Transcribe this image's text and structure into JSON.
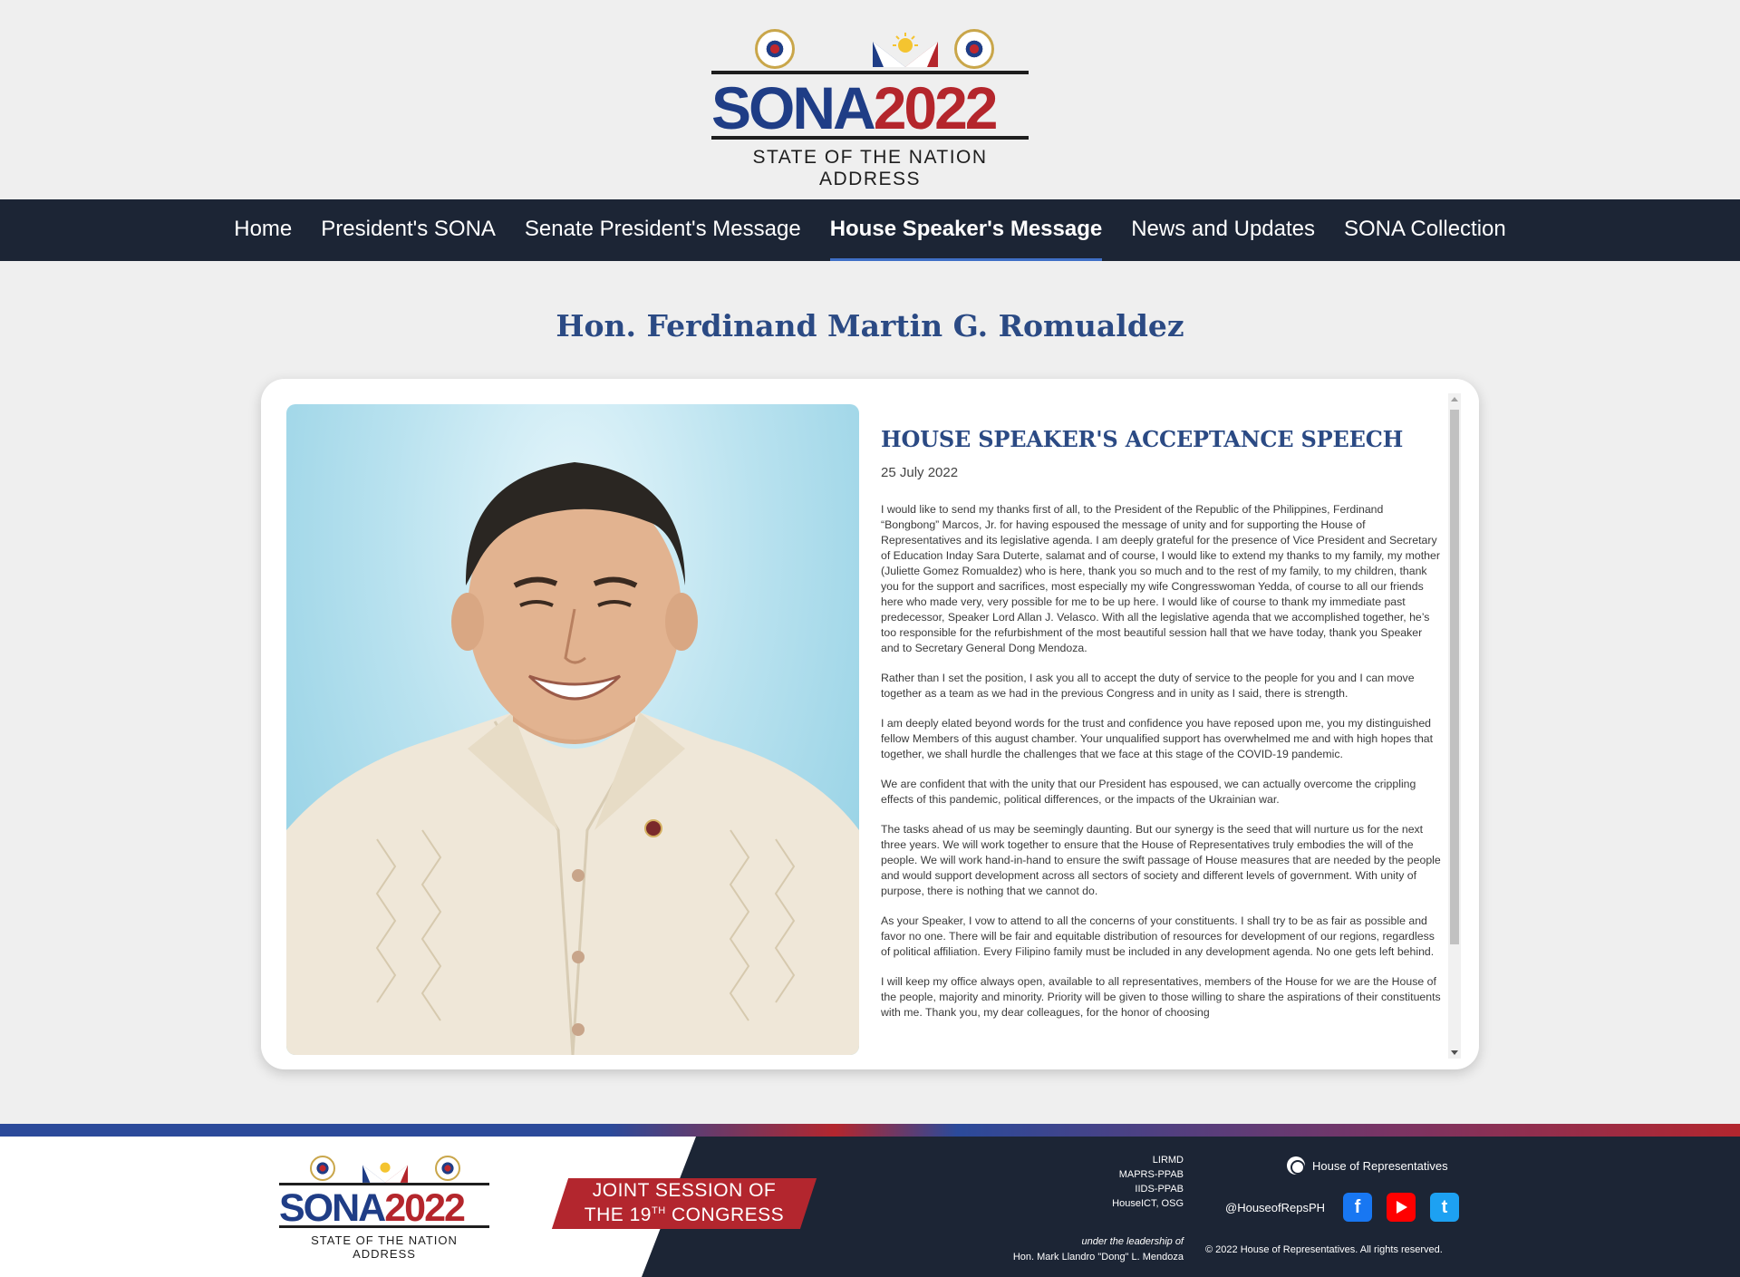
{
  "header": {
    "logo_main": "SONA",
    "logo_year": "2022",
    "logo_subtitle": "STATE OF THE NATION ADDRESS"
  },
  "nav": {
    "items": [
      {
        "label": "Home"
      },
      {
        "label": "President's SONA"
      },
      {
        "label": "Senate President's Message"
      },
      {
        "label": "House Speaker's Message"
      },
      {
        "label": "News and Updates"
      },
      {
        "label": "SONA Collection"
      }
    ],
    "active_index": 3
  },
  "page": {
    "title": "Hon. Ferdinand Martin G. Romualdez"
  },
  "speech": {
    "heading": "HOUSE SPEAKER'S ACCEPTANCE SPEECH",
    "date": "25 July 2022",
    "paragraphs": [
      "I would like to send my thanks first of all, to the President of the Republic of the Philippines, Ferdinand “Bongbong” Marcos, Jr. for having espoused the message of unity and for supporting the House of Representatives and its legislative agenda. I am deeply grateful for the presence of Vice President and Secretary of Education Inday Sara Duterte, salamat and of course, I would like to extend my thanks to my family, my mother (Juliette Gomez Romualdez) who is here, thank you so much and to the rest of my family, to my children, thank you for the support and sacrifices, most especially my wife Congresswoman Yedda, of course to all our friends here who made very, very possible for me to be up here. I would like of course to thank my immediate past predecessor, Speaker Lord Allan J. Velasco. With all the legislative agenda that we accomplished together, he’s too responsible for the refurbishment of the most beautiful session hall that we have today, thank you Speaker and to Secretary General Dong Mendoza.",
      "Rather than I set the position, I ask you all to accept the duty of service to the people for you and I can move together as a team as we had in the previous Congress and in unity as I said, there is strength.",
      "I am deeply elated beyond words for the trust and confidence you have reposed upon me, you my distinguished fellow Members of this august chamber. Your unqualified support has overwhelmed me and with high hopes that together, we shall hurdle the challenges that we face at this stage of the COVID-19 pandemic.",
      "We are confident that with the unity that our President has espoused, we can actually overcome the crippling effects of this pandemic, political differences, or the impacts of the Ukrainian war.",
      "The tasks ahead of us may be seemingly daunting. But our synergy is the seed that will nurture us for the next three years. We will work together to ensure that the House of Representatives truly embodies the will of the people. We will work hand-in-hand to ensure the swift passage of House measures that are needed by the people and would support development across all sectors of society and different levels of government. With unity of purpose, there is nothing that we cannot do.",
      "As your Speaker, I vow to attend to all the concerns of your constituents. I shall try to be as fair as possible and favor no one. There will be fair and equitable distribution of resources for development of our regions, regardless of political affiliation. Every Filipino family must be included in any development agenda. No one gets left behind.",
      "I will keep my office always open, available to all representatives, members of the House for we are the House of the people, majority and minority. Priority will be given to those willing to share the aspirations of their constituents with me. Thank you, my dear colleagues, for the honor of choosing"
    ]
  },
  "footer": {
    "logo_main": "SONA",
    "logo_year": "2022",
    "logo_subtitle": "STATE OF THE NATION ADDRESS",
    "joint_line1": "JOINT SESSION OF",
    "joint_line2_pre": "THE 19",
    "joint_line2_sup": "TH",
    "joint_line2_post": " CONGRESS",
    "credits": [
      "LIRMD",
      "MAPRS-PPAB",
      "IIDS-PPAB",
      "HouseICT, OSG"
    ],
    "leadership_label": "under the leadership of",
    "leadership_name": "Hon. Mark Llandro \"Dong\" L. Mendoza",
    "org_name": "House of Representatives",
    "social_handle": "@HouseofRepsPH",
    "social_icons": [
      "facebook-icon",
      "youtube-icon",
      "twitter-icon"
    ],
    "copyright": "© 2022 House of Representatives. All rights reserved."
  },
  "colors": {
    "navy": "#1c2535",
    "brand_blue": "#1f3d86",
    "brand_red": "#b4262c",
    "title_blue": "#2b4a84"
  }
}
